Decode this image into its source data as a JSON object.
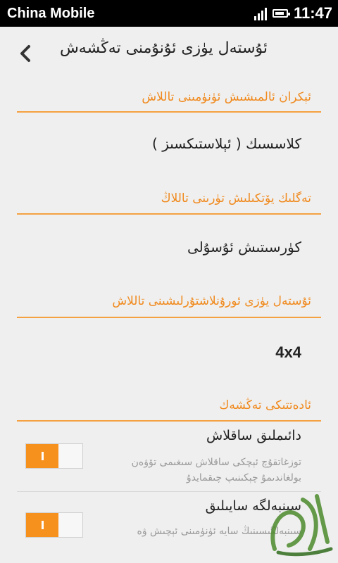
{
  "status_bar": {
    "carrier": "China Mobile",
    "time": "11:47",
    "signal_icon": "signal-icon",
    "battery_icon": "battery-icon"
  },
  "header": {
    "title": "ئۇستەل يۈزى ئۇنۇمنى تەڭشەش",
    "back_icon": "chevron-left-icon"
  },
  "sections": [
    {
      "title": "ئېكران ئالمىشىش ئۈنۈمىنى تاللاش",
      "value": "كلاسسىك ( ئېلاستىكسىز )"
    },
    {
      "title": "تەگلىك يۆتكىلىش تۈرىنى تاللاڭ",
      "value": "كۈرسىتىش ئۇسۇلى"
    },
    {
      "title": "ئۇستەل يۈزى ئورۇنلاشتۇرلىشىنى تاللاش",
      "value": "4x4"
    }
  ],
  "general": {
    "title": "ئادەتتىكى تەڭشەك",
    "items": [
      {
        "title": "دائىملىق ساقلاش",
        "desc": "توزغاتقۇچ ئېچكى ساقلاش سىغىمى تۆۋەن بولغاندىمۇ چېكىنىپ چىقمايدۇ",
        "enabled": true
      },
      {
        "title": "سىنبەلگە سايىلىق",
        "desc": "سىنبەلگىسىنىڭ سايە ئۈنۈمىنى ئېچىش ۋە",
        "enabled": true
      }
    ]
  },
  "accent_color": "#f08a1e"
}
